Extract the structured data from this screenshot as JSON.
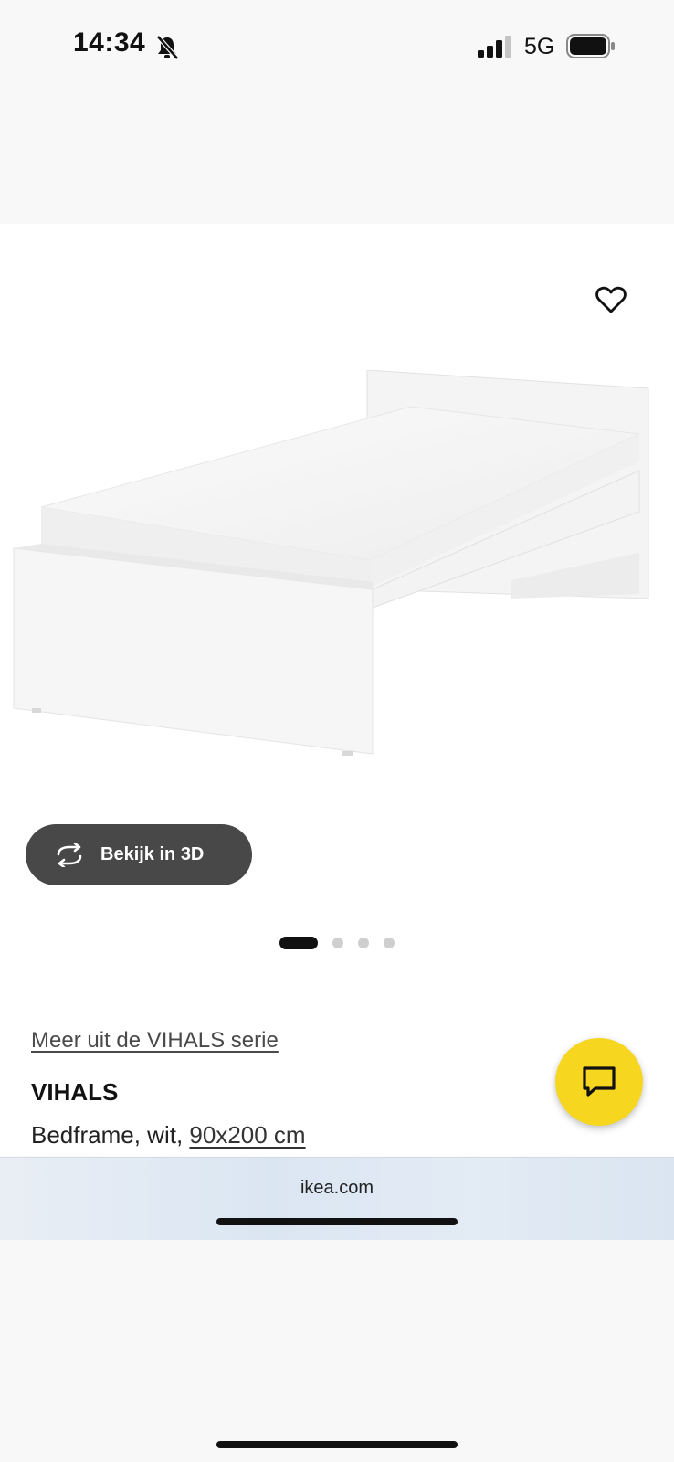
{
  "status_bar": {
    "time": "14:34",
    "network": "5G",
    "icons": [
      "bell-slash-icon",
      "signal-icon",
      "battery-icon"
    ]
  },
  "product": {
    "favorite_icon": "heart-icon",
    "image_alt": "bed-frame-image",
    "view_3d_label": "Bekijk in 3D",
    "view_3d_icon": "rotate-icon",
    "carousel": {
      "total": 4,
      "active_index": 0
    },
    "series_link": "Meer uit de VIHALS serie",
    "name": "VIHALS",
    "description_prefix": "Bedframe, wit, ",
    "size_link": "90x200 cm",
    "chat_icon": "chat-icon"
  },
  "browser": {
    "url": "ikea.com"
  },
  "colors": {
    "chat_button": "#f6d61f",
    "view_3d_button": "#484848",
    "background": "#f8f8f8"
  }
}
